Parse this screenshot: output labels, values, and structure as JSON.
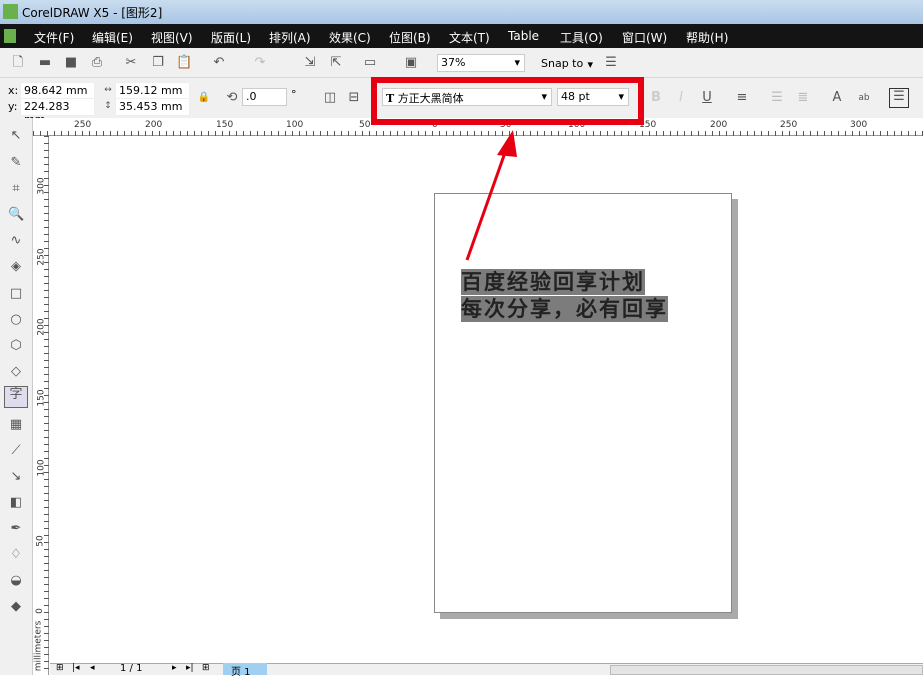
{
  "window": {
    "title": "CorelDRAW X5 - [图形2]"
  },
  "menu": [
    "文件(F)",
    "编辑(E)",
    "视图(V)",
    "版面(L)",
    "排列(A)",
    "效果(C)",
    "位图(B)",
    "文本(T)",
    "Table",
    "工具(O)",
    "窗口(W)",
    "帮助(H)"
  ],
  "toolbar": {
    "zoom": "37%",
    "snap": "Snap to"
  },
  "property_bar": {
    "x_label": "x:",
    "x": "98.642 mm",
    "y_label": "y:",
    "y": "224.283 mm",
    "width": "159.12 mm",
    "height": "35.453 mm",
    "rotation": ".0",
    "degree": "°",
    "font": "方正大黑简体",
    "font_size": "48 pt"
  },
  "rulers": {
    "top": [
      "250",
      "200",
      "150",
      "100",
      "50",
      "0",
      "50",
      "100",
      "150",
      "200",
      "250",
      "300"
    ],
    "left": [
      "300",
      "250",
      "200",
      "150",
      "100",
      "50",
      "0"
    ],
    "unit": "millimeters"
  },
  "canvas": {
    "lines": [
      "百度经验回享计划",
      "每次分享，必有回享"
    ]
  },
  "status": {
    "page_count": "1 / 1",
    "page_tab": "页 1"
  },
  "colors": {
    "highlight": "#e60012",
    "menubar": "#141414"
  }
}
